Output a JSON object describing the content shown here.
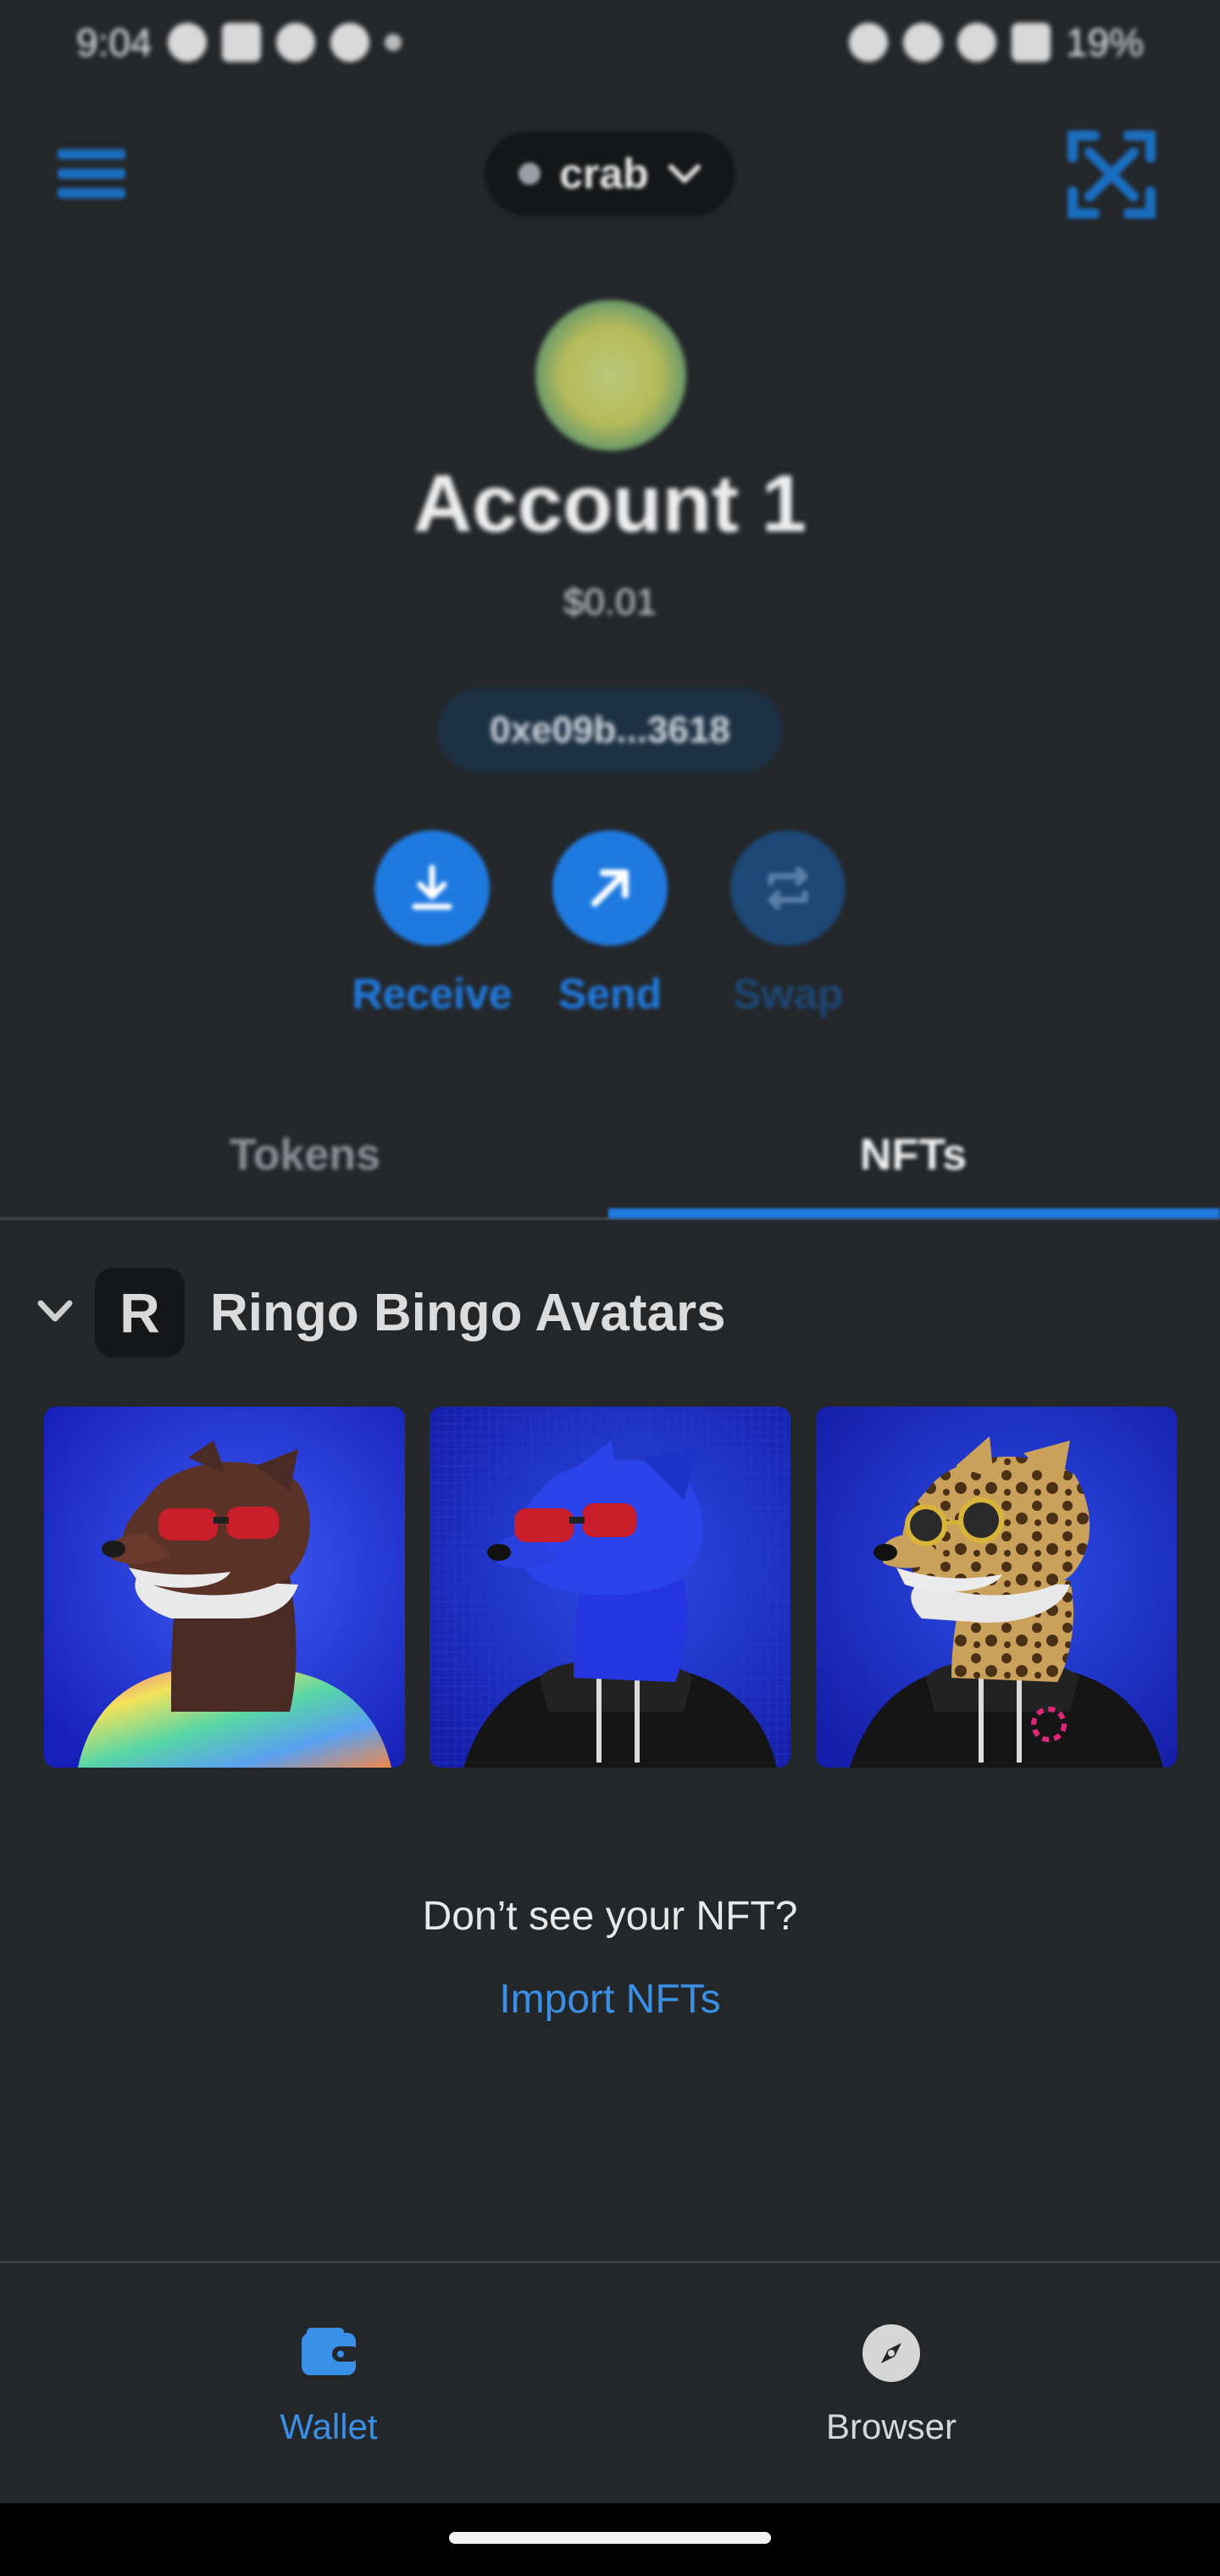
{
  "status_bar": {
    "time": "9:04",
    "battery": "19%"
  },
  "header": {
    "network_name": "crab"
  },
  "account": {
    "name": "Account 1",
    "balance": "$0.01",
    "address": "0xe09b...3618"
  },
  "actions": [
    {
      "label": "Receive"
    },
    {
      "label": "Send"
    },
    {
      "label": "Swap"
    }
  ],
  "tabs": [
    {
      "label": "Tokens",
      "active": false
    },
    {
      "label": "NFTs",
      "active": true
    }
  ],
  "collection": {
    "badge_letter": "R",
    "name": "Ringo Bingo Avatars"
  },
  "empty_prompt": {
    "question": "Don’t see your NFT?",
    "link": "Import NFTs"
  },
  "bottom_nav": [
    {
      "label": "Wallet",
      "icon": "wallet-icon",
      "active": true
    },
    {
      "label": "Browser",
      "icon": "compass-icon",
      "active": false
    }
  ],
  "colors": {
    "background": "#24272a",
    "accent": "#1f7ae0",
    "link": "#3a8fe6"
  }
}
